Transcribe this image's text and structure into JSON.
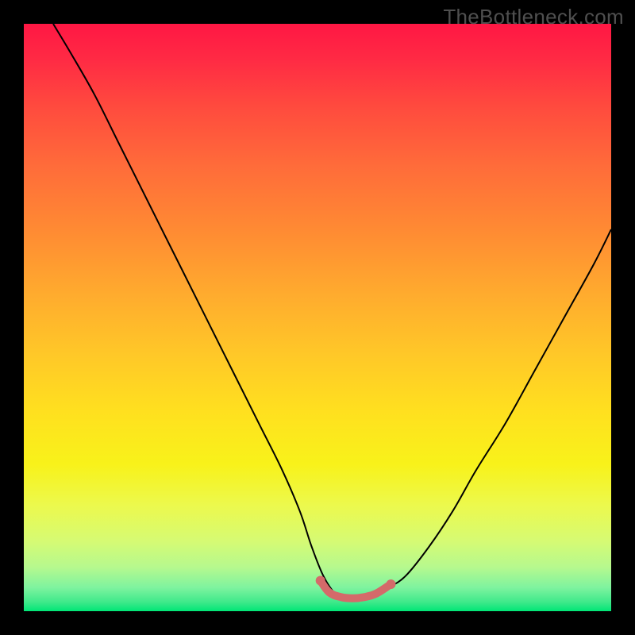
{
  "watermark": "TheBottleneck.com",
  "chart_data": {
    "type": "line",
    "title": "",
    "xlabel": "",
    "ylabel": "",
    "xlim": [
      0,
      100
    ],
    "ylim": [
      0,
      100
    ],
    "grid": false,
    "legend": false,
    "background_gradient_stops": [
      {
        "offset": 0.0,
        "color": "#ff1744"
      },
      {
        "offset": 0.06,
        "color": "#ff2a44"
      },
      {
        "offset": 0.14,
        "color": "#ff4a3e"
      },
      {
        "offset": 0.24,
        "color": "#ff6b3a"
      },
      {
        "offset": 0.35,
        "color": "#ff8a33"
      },
      {
        "offset": 0.46,
        "color": "#ffab2e"
      },
      {
        "offset": 0.56,
        "color": "#ffc728"
      },
      {
        "offset": 0.66,
        "color": "#ffe01f"
      },
      {
        "offset": 0.75,
        "color": "#f8f21a"
      },
      {
        "offset": 0.82,
        "color": "#ecf94d"
      },
      {
        "offset": 0.88,
        "color": "#d6fa73"
      },
      {
        "offset": 0.925,
        "color": "#b6f98e"
      },
      {
        "offset": 0.96,
        "color": "#7ef39f"
      },
      {
        "offset": 0.985,
        "color": "#3de98a"
      },
      {
        "offset": 1.0,
        "color": "#00e676"
      }
    ],
    "series": [
      {
        "name": "bottleneck-curve",
        "color": "#000000",
        "stroke_width": 2,
        "x": [
          5,
          8,
          12,
          16,
          20,
          24,
          28,
          32,
          36,
          40,
          44,
          47,
          49,
          51,
          53,
          55,
          57,
          60,
          62,
          65,
          69,
          73,
          77,
          82,
          87,
          92,
          97,
          100
        ],
        "values": [
          100,
          95,
          88,
          80,
          72,
          64,
          56,
          48,
          40,
          32,
          24,
          17,
          11,
          6,
          3,
          2,
          2,
          3,
          4,
          6,
          11,
          17,
          24,
          32,
          41,
          50,
          59,
          65
        ]
      },
      {
        "name": "flat-highlight",
        "color": "#d46a6a",
        "stroke_width": 10,
        "linecap": "round",
        "x": [
          50.5,
          52,
          54,
          56,
          58,
          60,
          62.5
        ],
        "values": [
          5.2,
          3.2,
          2.4,
          2.2,
          2.4,
          3.0,
          4.6
        ]
      }
    ],
    "flat_highlight_endpoints": {
      "left": {
        "x": 50.5,
        "y": 5.2,
        "r": 6,
        "color": "#d46a6a"
      },
      "right": {
        "x": 62.5,
        "y": 4.6,
        "r": 6,
        "color": "#d46a6a"
      }
    }
  }
}
